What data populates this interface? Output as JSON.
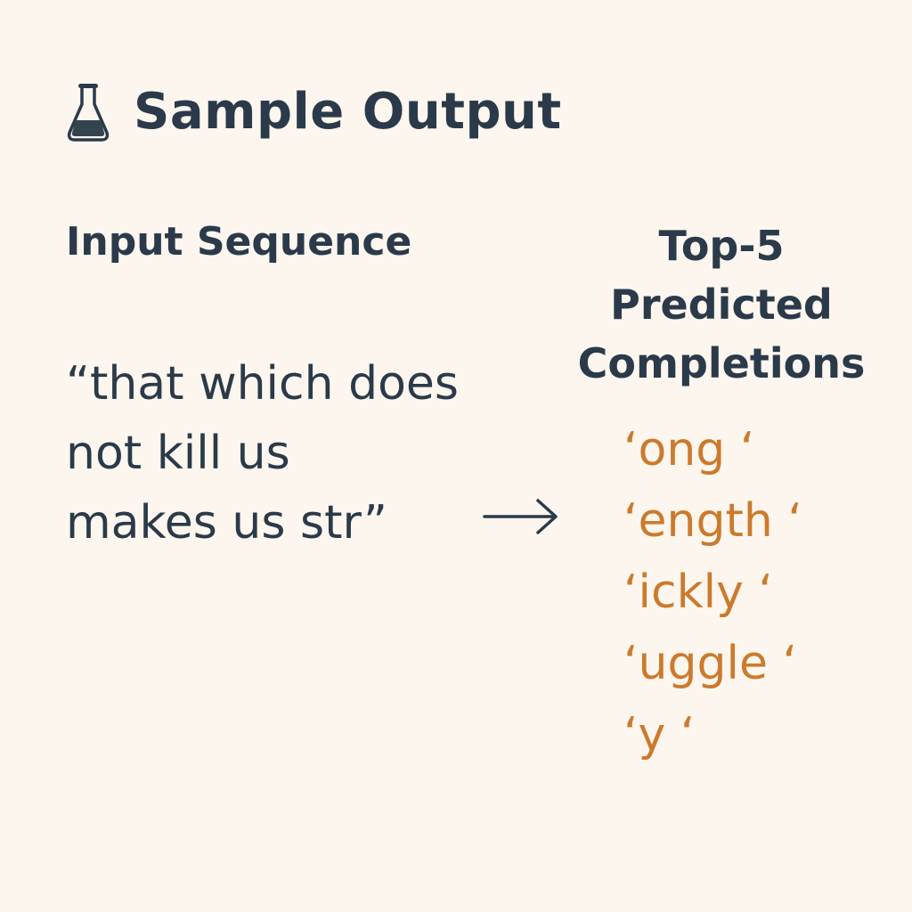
{
  "header": {
    "title": "Sample Output",
    "icon": "flask-icon"
  },
  "input": {
    "heading": "Input Sequence",
    "lines": [
      "“that which does",
      "not kill us",
      "makes us str”"
    ]
  },
  "arrow": {
    "icon": "right-arrow-icon"
  },
  "completions": {
    "heading_lines": [
      "Top-5",
      "Predicted",
      "Completions"
    ],
    "items": [
      "‘ong ‘",
      "‘ength ‘",
      "‘ickly ‘",
      "‘uggle ‘",
      "‘y ‘"
    ]
  },
  "colors": {
    "background": "#fcf6ee",
    "text": "#2b3a4a",
    "accent": "#cc7a2d"
  }
}
